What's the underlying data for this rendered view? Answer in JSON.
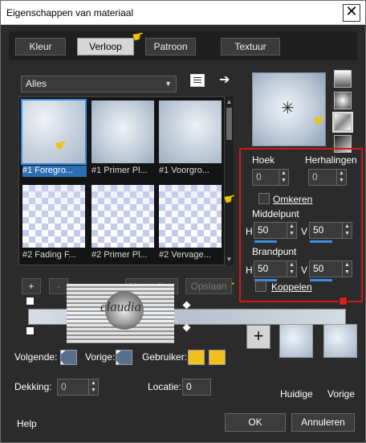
{
  "window": {
    "title": "Eigenschappen van materiaal",
    "close_glyph": "✕"
  },
  "tabs": [
    {
      "label": "Kleur"
    },
    {
      "label": "Verloop"
    },
    {
      "label": "Patroon"
    },
    {
      "label": "Textuur"
    }
  ],
  "gallery": {
    "filter_value": "Alles",
    "tiles": [
      {
        "caption": "#1 Foregro..."
      },
      {
        "caption": "#1 Primer Pl..."
      },
      {
        "caption": "#1 Voorgro..."
      },
      {
        "caption": "#2 Fading F..."
      },
      {
        "caption": "#2 Primer Pl..."
      },
      {
        "caption": "#2 Vervage..."
      }
    ]
  },
  "properties": {
    "hoek_label": "Hoek",
    "hoek_value": "0",
    "herhalingen_label": "Herhalingen",
    "herhalingen_value": "0",
    "omkeren_label": "Omkeren",
    "middelpunt_label": "Middelpunt",
    "h_label": "H",
    "v_label": "V",
    "middelpunt_h": "50",
    "middelpunt_v": "50",
    "brandpunt_label": "Brandpunt",
    "brandpunt_h": "50",
    "brandpunt_v": "50",
    "koppelen_label": "Koppelen"
  },
  "editor": {
    "add_label": "+",
    "remove_label": "-",
    "herstellen_label": "Herstellen",
    "opslaan_label": "Opslaan",
    "watermark_text": "claudia"
  },
  "bottom": {
    "volgende_label": "Volgende:",
    "vorige_label": "Vorige:",
    "gebruiker_label": "Gebruiker:",
    "dekking_label": "Dekking:",
    "dekking_value": "0",
    "locatie_label": "Locatie:",
    "locatie_value": "0",
    "huidige_label": "Huidige",
    "vorige_label2": "Vorige",
    "user_color": "#f0c020"
  },
  "buttons": {
    "help_label": "Help",
    "ok_label": "OK",
    "cancel_label": "Annuleren"
  },
  "icons": {
    "pointer": "☛",
    "arrow": "➔",
    "star": "✳",
    "up": "▲",
    "down": "▼",
    "checkmark": "✓"
  }
}
